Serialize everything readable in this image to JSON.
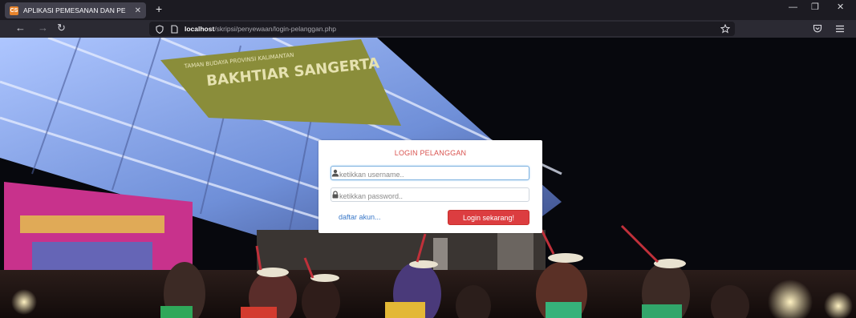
{
  "browser": {
    "tab_title": "APLIKASI PEMESANAN DAN PE",
    "tab_close_glyph": "✕",
    "favicon_text": "CS",
    "new_tab_glyph": "+",
    "url_host": "localhost",
    "url_path": "/skripsi/penyewaan/login-pelanggan.php",
    "icons": [
      "back-arrow-icon",
      "forward-arrow-icon",
      "reload-icon",
      "shield-icon",
      "page-icon",
      "bookmark-star-icon",
      "pocket-icon",
      "menu-icon"
    ],
    "window_controls": {
      "minimize": "—",
      "restore": "❐",
      "close": "✕"
    }
  },
  "background_photo": {
    "banner_text": "TAMAN BUDAYA PROVINSI KALIMANTAN",
    "banner_title": "BAKHTIAR SANGERTA"
  },
  "login": {
    "title": "LOGIN PELANGGAN",
    "username_placeholder": "ketikkan username..",
    "password_placeholder": "ketikkan password..",
    "register_link": "daftar akun...",
    "submit_label": "Login sekarang!"
  },
  "colors": {
    "accent_red": "#dc3d40",
    "link_blue": "#3a78c8",
    "title_red": "#d9534f"
  }
}
